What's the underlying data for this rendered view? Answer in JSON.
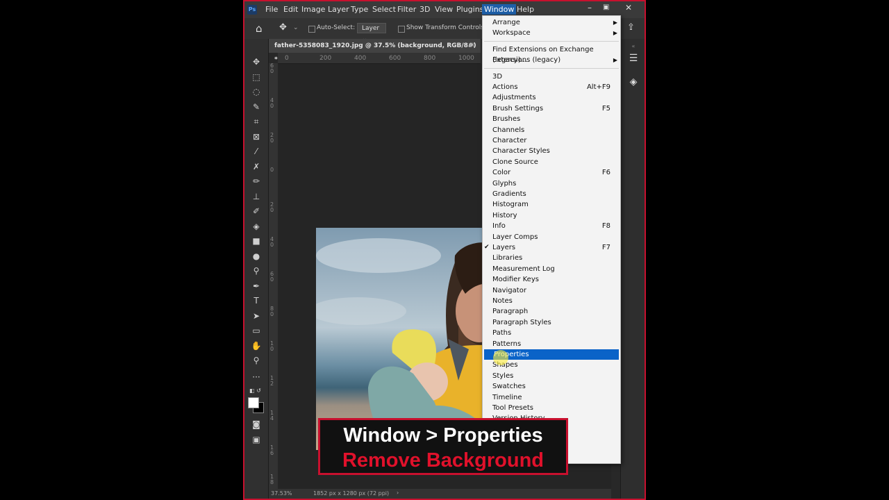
{
  "menubar": {
    "app_icon": "Ps",
    "items": [
      "File",
      "Edit",
      "Image",
      "Layer",
      "Type",
      "Select",
      "Filter",
      "3D",
      "View",
      "Plugins",
      "Window",
      "Help"
    ],
    "active_item": "Window"
  },
  "options_bar": {
    "auto_select_label": "Auto-Select:",
    "auto_select_value": "Layer",
    "transform_label": "Show Transform Controls"
  },
  "document": {
    "tab_title": "father-5358083_1920.jpg @ 37.5% (background, RGB/8#) *",
    "ruler_top_ticks": [
      "0",
      "200",
      "400",
      "600",
      "800",
      "1000"
    ],
    "ruler_left_ticks": [
      "6",
      "0",
      "4",
      "0",
      "2",
      "0",
      "0",
      "2",
      "0",
      "4",
      "0",
      "6",
      "0",
      "8",
      "0",
      "1",
      "0",
      "1",
      "2",
      "1",
      "4",
      "1",
      "6",
      "1",
      "8"
    ]
  },
  "status": {
    "zoom": "37.53%",
    "doc_info": "1852 px x 1280 px (72 ppi)"
  },
  "window_menu": {
    "items": [
      {
        "label": "Arrange",
        "submenu": true
      },
      {
        "label": "Workspace",
        "submenu": true
      },
      {
        "sep": true
      },
      {
        "label": "Find Extensions on Exchange (legacy)..."
      },
      {
        "label": "Extensions (legacy)",
        "submenu": true
      },
      {
        "sep": true
      },
      {
        "label": "3D"
      },
      {
        "label": "Actions",
        "shortcut": "Alt+F9"
      },
      {
        "label": "Adjustments"
      },
      {
        "label": "Brush Settings",
        "shortcut": "F5"
      },
      {
        "label": "Brushes"
      },
      {
        "label": "Channels"
      },
      {
        "label": "Character"
      },
      {
        "label": "Character Styles"
      },
      {
        "label": "Clone Source"
      },
      {
        "label": "Color",
        "shortcut": "F6"
      },
      {
        "label": "Glyphs"
      },
      {
        "label": "Gradients"
      },
      {
        "label": "Histogram"
      },
      {
        "label": "History"
      },
      {
        "label": "Info",
        "shortcut": "F8"
      },
      {
        "label": "Layer Comps"
      },
      {
        "label": "Layers",
        "shortcut": "F7",
        "checked": true
      },
      {
        "label": "Libraries"
      },
      {
        "label": "Measurement Log"
      },
      {
        "label": "Modifier Keys"
      },
      {
        "label": "Navigator"
      },
      {
        "label": "Notes"
      },
      {
        "label": "Paragraph"
      },
      {
        "label": "Paragraph Styles"
      },
      {
        "label": "Paths"
      },
      {
        "label": "Patterns"
      },
      {
        "label": "Properties",
        "highlighted": true
      },
      {
        "label": "Shapes"
      },
      {
        "label": "Styles"
      },
      {
        "label": "Swatches"
      },
      {
        "label": "Timeline"
      },
      {
        "label": "Tool Presets"
      },
      {
        "label": "Version History"
      }
    ]
  },
  "caption": {
    "line1": "Window > Properties",
    "line2": "Remove Background"
  },
  "colors": {
    "accent_red": "#c8102e",
    "highlight_blue": "#0a63c8"
  }
}
